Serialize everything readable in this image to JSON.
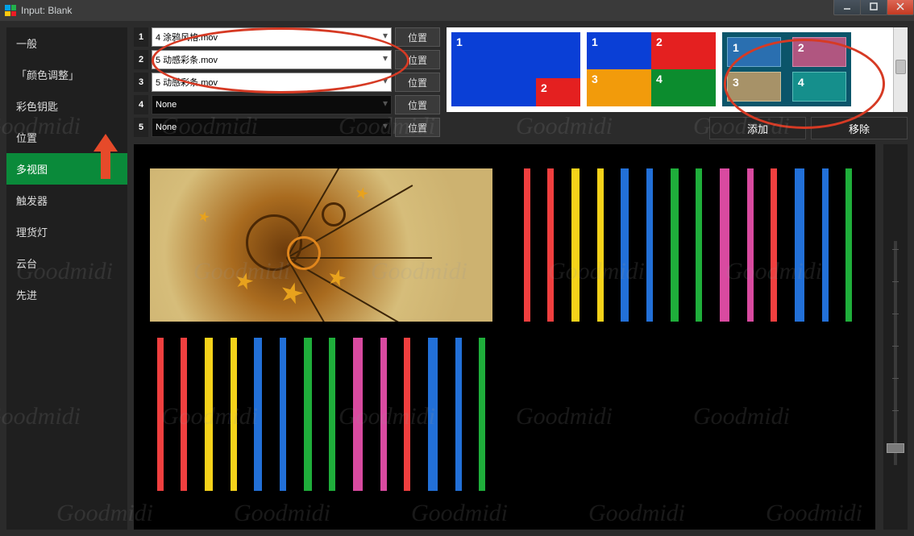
{
  "titlebar": {
    "title": "Input: Blank"
  },
  "sidebar": {
    "items": [
      {
        "label": "一般"
      },
      {
        "label": "「颜色调整」"
      },
      {
        "label": "彩色钥匙"
      },
      {
        "label": "位置"
      },
      {
        "label": "多视图",
        "active": true
      },
      {
        "label": "触发器"
      },
      {
        "label": "理货灯"
      },
      {
        "label": "云台"
      },
      {
        "label": "先进"
      }
    ]
  },
  "sources": {
    "position_btn": "位置",
    "rows": [
      {
        "n": "1",
        "value": "4 涂鸦风格.mov",
        "dark": false
      },
      {
        "n": "2",
        "value": "5 动感彩条.mov",
        "dark": false
      },
      {
        "n": "3",
        "value": "5 动感彩条.mov",
        "dark": false
      },
      {
        "n": "4",
        "value": "None",
        "dark": true
      },
      {
        "n": "5",
        "value": "None",
        "dark": true
      }
    ]
  },
  "actions": {
    "add": "添加",
    "remove": "移除"
  },
  "watermark": "Goodmidi"
}
